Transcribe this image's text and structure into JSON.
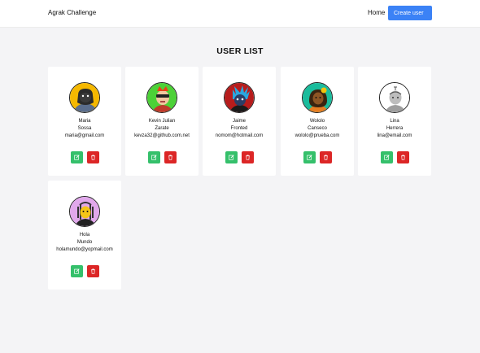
{
  "header": {
    "brand": "Agrak Challenge",
    "home_link": "Home",
    "create_button": "Create user"
  },
  "title": "USER LIST",
  "colors": {
    "primary": "#3b82f6",
    "edit": "#35c06b",
    "delete": "#dc2626"
  },
  "icons": {
    "edit": "edit-icon",
    "delete": "trash-icon"
  },
  "users": [
    {
      "name": "Maria",
      "last_name": "Sossa",
      "email": "maria@gmail.com"
    },
    {
      "name": "Kevin Julian",
      "last_name": "Zarate",
      "email": "kevza32@github.com.net"
    },
    {
      "name": "Jaime",
      "last_name": "Fronted",
      "email": "nomom@hotmail.com"
    },
    {
      "name": "Wololo",
      "last_name": "Canseco",
      "email": "wololo@prueba.com"
    },
    {
      "name": "Lina",
      "last_name": "Herrera",
      "email": "lina@email.com"
    },
    {
      "name": "Hola",
      "last_name": "Mundo",
      "email": "holamundo@yopmail.com"
    }
  ]
}
